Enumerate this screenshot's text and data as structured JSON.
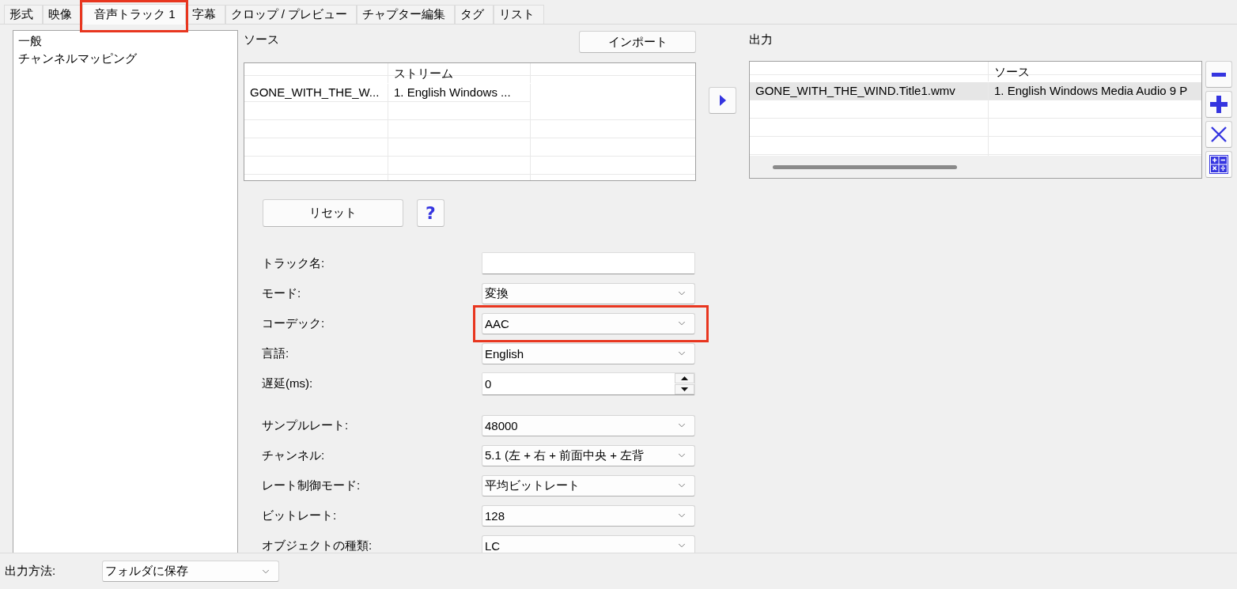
{
  "tabs": [
    {
      "label": "形式",
      "selected": false,
      "highlighted": false
    },
    {
      "label": "映像",
      "selected": false,
      "highlighted": false
    },
    {
      "label": "音声トラック 1",
      "selected": true,
      "highlighted": true
    },
    {
      "label": "字幕",
      "selected": false,
      "highlighted": false
    },
    {
      "label": "クロップ / プレビュー",
      "selected": false,
      "highlighted": false
    },
    {
      "label": "チャプター編集",
      "selected": false,
      "highlighted": false
    },
    {
      "label": "タグ",
      "selected": false,
      "highlighted": false
    },
    {
      "label": "リスト",
      "selected": false,
      "highlighted": false
    }
  ],
  "sidebar": {
    "items": [
      {
        "label": "一般",
        "selected": false
      },
      {
        "label": "チャンネルマッピング",
        "selected": false
      }
    ]
  },
  "source": {
    "title": "ソース",
    "import_button": "インポート",
    "table": {
      "headings": {
        "column_2": "ストリーム"
      },
      "rows": [
        {
          "column_1": "GONE_WITH_THE_W...",
          "column_2": "1. English Windows ...",
          "selected": false
        }
      ]
    }
  },
  "actions": {
    "reset_button": "リセット",
    "help_button": "?"
  },
  "form": {
    "sections": [
      {
        "fields": [
          {
            "label": "トラック名:",
            "kind": "text",
            "highlighted": false
          },
          {
            "label": "モード:",
            "kind": "dropdown",
            "value": "変換",
            "highlighted": false
          },
          {
            "label": "コーデック:",
            "kind": "dropdown",
            "value": "AAC",
            "highlighted": true
          },
          {
            "label": "言語:",
            "kind": "dropdown",
            "value": "English",
            "highlighted": false
          },
          {
            "label": "遅延(ms):",
            "kind": "spin",
            "value": "0",
            "highlighted": false
          }
        ]
      },
      {
        "fields": [
          {
            "label": "サンプルレート:",
            "kind": "dropdown",
            "value": "48000",
            "highlighted": false
          },
          {
            "label": "チャンネル:",
            "kind": "dropdown",
            "value": "5.1 (左 + 右 + 前面中央 + 左背",
            "highlighted": false
          },
          {
            "label": "レート制御モード:",
            "kind": "dropdown",
            "value": "平均ビットレート",
            "highlighted": false
          },
          {
            "label": "ビットレート:",
            "kind": "dropdown",
            "value": "128",
            "highlighted": false
          },
          {
            "label": "オブジェクトの種類:",
            "kind": "dropdown",
            "value": "LC",
            "highlighted": false
          }
        ]
      }
    ]
  },
  "output": {
    "title": "出力",
    "table": {
      "headings": {
        "column_2": "ソース"
      },
      "rows": [
        {
          "column_1": "GONE_WITH_THE_WIND.Title1.wmv",
          "column_2": "1. English Windows Media Audio 9 P",
          "selected": true
        }
      ]
    }
  },
  "output_method": {
    "label": "出力方法:",
    "value": "フォルダに保存"
  }
}
